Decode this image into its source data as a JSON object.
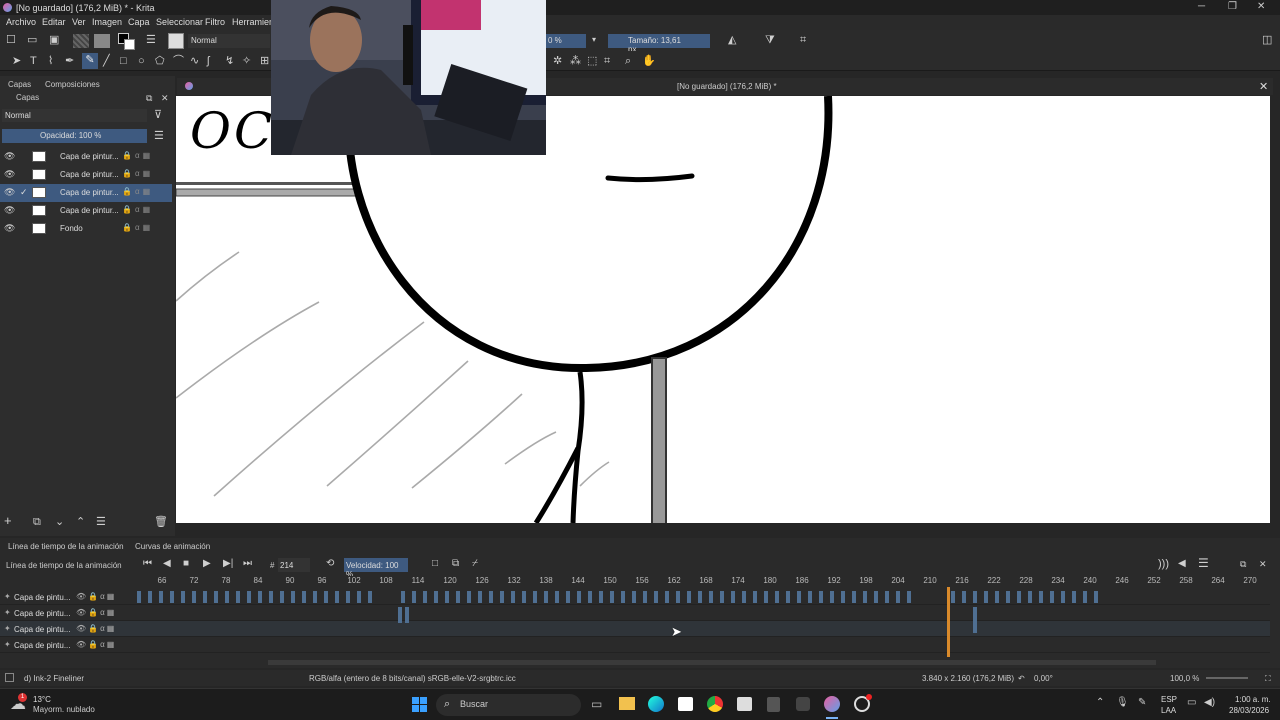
{
  "window": {
    "title": "[No guardado]  (176,2 MiB) * - Krita"
  },
  "menu": [
    "Archivo",
    "Editar",
    "Ver",
    "Imagen",
    "Capa",
    "Seleccionar",
    "Filtro",
    "Herramien"
  ],
  "toolbar": {
    "blend_mode": "Normal",
    "opacity_partial": "0 %",
    "size_label": "Tamaño: 13,61 px"
  },
  "panel": {
    "tabs": [
      "Capas",
      "Composiciones"
    ],
    "title": "Capas",
    "blend_mode": "Normal",
    "opacity": "Opacidad:  100 %",
    "layers": [
      {
        "name": "Capa de pintur...",
        "selected": false,
        "checked": false
      },
      {
        "name": "Capa de pintur...",
        "selected": false,
        "checked": false
      },
      {
        "name": "Capa de pintur...",
        "selected": true,
        "checked": true
      },
      {
        "name": "Capa de pintur...",
        "selected": false,
        "checked": false
      },
      {
        "name": "Fondo",
        "selected": false,
        "checked": false
      }
    ]
  },
  "document_tab": "[No guardado]  (176,2 MiB) *",
  "canvas": {
    "text_fragment": "OC"
  },
  "timeline": {
    "tabs": [
      "Línea de tiempo de la animación",
      "Curvas de animación"
    ],
    "title": "Línea de tiempo de la animación",
    "frame": "214",
    "speed": "Velocidad: 100 %",
    "ruler": [
      "66",
      "72",
      "78",
      "84",
      "90",
      "96",
      "102",
      "108",
      "114",
      "120",
      "126",
      "132",
      "138",
      "144",
      "150",
      "156",
      "162",
      "168",
      "174",
      "180",
      "186",
      "192",
      "198",
      "204",
      "210",
      "216",
      "222",
      "228",
      "234",
      "240",
      "246",
      "252",
      "258",
      "264",
      "270"
    ],
    "rows": [
      "Capa de pintu...",
      "Capa de pintu...",
      "Capa de pintu...",
      "Capa de pintu..."
    ]
  },
  "status": {
    "brush": "d) Ink-2 Fineliner",
    "color_space": "RGB/alfa (entero de 8 bits/canal)  sRGB-elle-V2-srgbtrc.icc",
    "dimensions": "3.840 x 2.160 (176,2 MiB)",
    "rotation": "0,00°",
    "zoom": "100,0 %"
  },
  "taskbar": {
    "weather_temp": "13°C",
    "weather_desc": "Mayorm. nublado",
    "weather_badge": "1",
    "search": "Buscar",
    "lang_top": "ESP",
    "lang_bottom": "LAA",
    "time": "1:00 a. m.",
    "date": "28/03/2026"
  },
  "colors": {
    "accent": "#3e5a80",
    "playhead": "#d98a2b",
    "frame": "#4f6f92"
  }
}
